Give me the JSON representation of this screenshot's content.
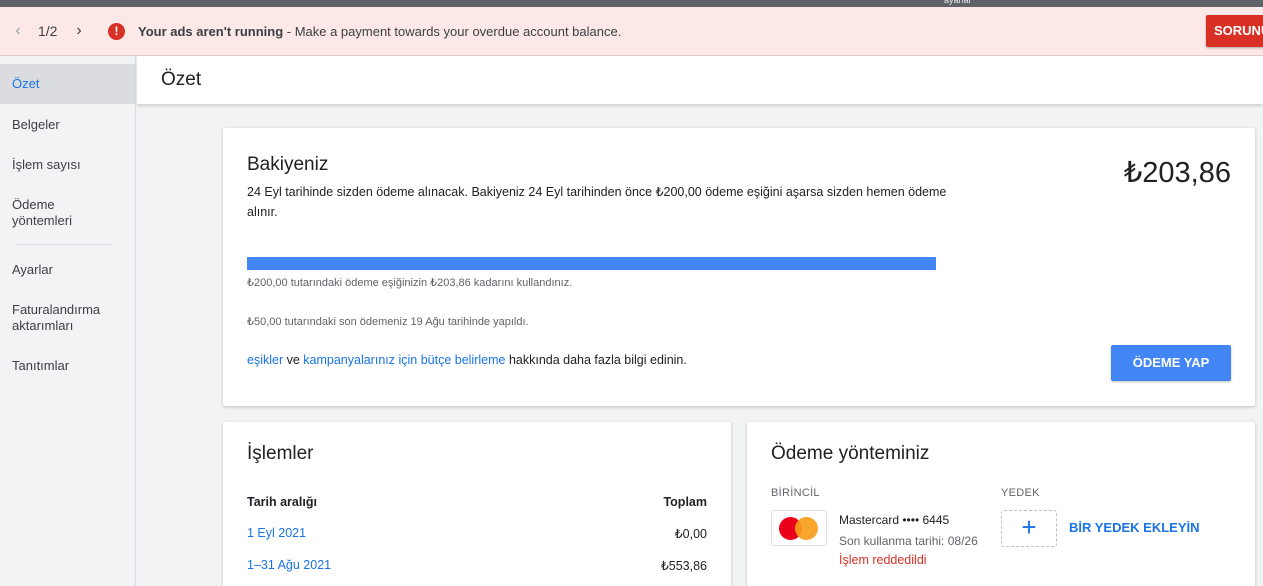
{
  "topstrip": {
    "label": "ayarlar"
  },
  "banner": {
    "pager": "1/2",
    "message_bold": "Your ads aren't running",
    "message_rest": " - Make a payment towards your overdue account balance.",
    "action_label": "SORUNU",
    "color": "#fce8e6",
    "accent": "#d93025"
  },
  "sidebar": {
    "items": [
      {
        "label": "Özet"
      },
      {
        "label": "Belgeler"
      },
      {
        "label": "İşlem sayısı"
      },
      {
        "label": "Ödeme yöntemleri"
      },
      {
        "label": "Ayarlar"
      },
      {
        "label": "Faturalandırma aktarımları"
      },
      {
        "label": "Tanıtımlar"
      }
    ]
  },
  "page": {
    "title": "Özet"
  },
  "balance": {
    "title": "Bakiyeniz",
    "amount": "₺203,86",
    "description": "24 Eyl tarihinde sizden ödeme alınacak. Bakiyeniz 24 Eyl tarihinden önce ₺200,00 ödeme eşiğini aşarsa sizden hemen ödeme alınır.",
    "threshold_progress_percent": 100,
    "threshold_note": "₺200,00 tutarındaki ödeme eşiğinizin ₺203,86 kadarını kullandınız.",
    "last_payment_note": "₺50,00 tutarındaki son ödemeniz 19 Ağu tarihinde yapıldı.",
    "learn_link1": "eşikler",
    "learn_mid": " ve ",
    "learn_link2": "kampanyalarınız için bütçe belirleme",
    "learn_end": " hakkında daha fazla bilgi edinin.",
    "pay_button": "ÖDEME YAP"
  },
  "transactions": {
    "title": "İşlemler",
    "col_date": "Tarih aralığı",
    "col_total": "Toplam",
    "rows": [
      {
        "date": "1 Eyl 2021",
        "total": "₺0,00"
      },
      {
        "date": "1–31 Ağu 2021",
        "total": "₺553,86"
      }
    ]
  },
  "payment_method": {
    "title": "Ödeme yönteminiz",
    "primary_label": "BİRİNCİL",
    "backup_label": "YEDEK",
    "card_name": "Mastercard •••• 6445",
    "card_expiry": "Son kullanma tarihi: 08/26",
    "card_status": "İşlem reddedildi",
    "add_backup_label": "BİR YEDEK EKLEYİN",
    "card_icon": "mastercard-logo",
    "add_icon": "plus-icon"
  },
  "colors": {
    "link": "#1a73e8",
    "primary_button": "#4285f4",
    "error": "#d93025"
  }
}
